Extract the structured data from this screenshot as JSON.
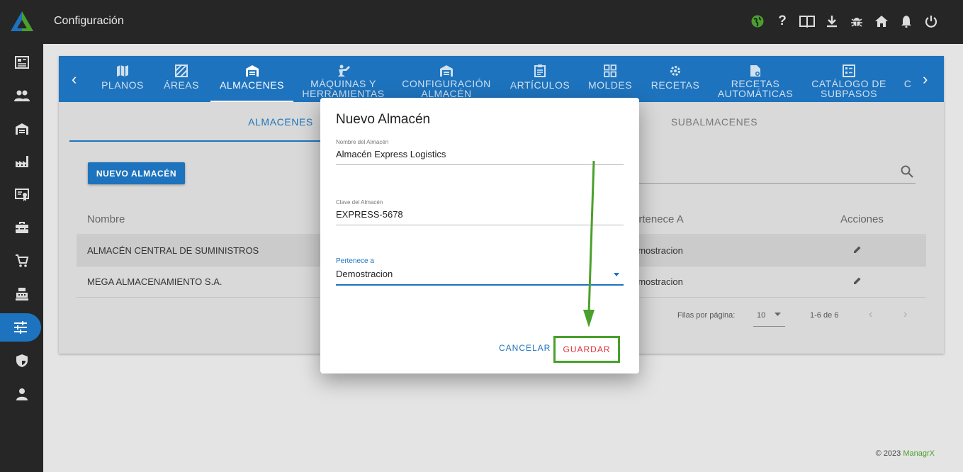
{
  "header": {
    "title": "Configuración",
    "icons": [
      "globe-icon",
      "help-icon",
      "manual-book-icon",
      "download-icon",
      "bug-icon",
      "home-icon",
      "notifications-bell-icon",
      "power-icon"
    ]
  },
  "sidebar": {
    "items": [
      {
        "icon": "dashboard-icon"
      },
      {
        "icon": "users-icon"
      },
      {
        "icon": "warehouse-icon"
      },
      {
        "icon": "factory-icon"
      },
      {
        "icon": "certificate-icon"
      },
      {
        "icon": "toolbox-icon"
      },
      {
        "icon": "cart-icon"
      },
      {
        "icon": "cash-register-icon"
      },
      {
        "icon": "settings-sliders-icon",
        "active": true
      },
      {
        "icon": "shield-icon"
      },
      {
        "icon": "user-icon"
      }
    ]
  },
  "tabs": [
    {
      "label": "PLANOS",
      "icon": "map-icon"
    },
    {
      "label": "ÁREAS",
      "icon": "area-icon"
    },
    {
      "label": "ALMACENES",
      "icon": "warehouse-icon",
      "active": true
    },
    {
      "label": "MÁQUINAS Y HERRAMIENTAS",
      "icon": "machine-icon"
    },
    {
      "label": "CONFIGURACIÓN ALMACÉN",
      "icon": "warehouse-config-icon"
    },
    {
      "label": "ARTÍCULOS",
      "icon": "clipboard-icon"
    },
    {
      "label": "MOLDES",
      "icon": "grid-icon"
    },
    {
      "label": "RECETAS",
      "icon": "recipe-gear-icon"
    },
    {
      "label": "RECETAS AUTOMÁTICAS",
      "icon": "auto-recipe-icon"
    },
    {
      "label": "CATÁLOGO DE SUBPASOS",
      "icon": "catalog-icon"
    },
    {
      "label": "C",
      "icon": ""
    }
  ],
  "subtabs": {
    "almacenes": "ALMACENES",
    "subalmacenes": "SUBALMACENES"
  },
  "main": {
    "new_button": "NUEVO ALMACÉN",
    "columns": {
      "nombre": "Nombre",
      "pertenece": "ertenece A",
      "acciones": "Acciones"
    },
    "rows": [
      {
        "nombre": "ALMACÉN CENTRAL DE SUMINISTROS",
        "pertenece": "emostracion"
      },
      {
        "nombre": "MEGA ALMACENAMIENTO S.A.",
        "pertenece": "emostracion"
      }
    ],
    "pager": {
      "rows_label": "Filas por página:",
      "rows_value": "10",
      "range": "1-6 de 6"
    }
  },
  "footer": {
    "copyright": "© 2023",
    "brand": "ManagrX"
  },
  "modal": {
    "title": "Nuevo Almacén",
    "nombre_label": "Nombre del Almacén",
    "nombre_value": "Almacén Express Logistics",
    "clave_label": "Clave del Almacén",
    "clave_value": "EXPRESS-5678",
    "pertenece_label": "Pertenece a",
    "pertenece_value": "Demostracion",
    "cancel": "CANCELAR",
    "save": "GUARDAR"
  },
  "colors": {
    "primary": "#1e73be",
    "annotation": "#4aa02c",
    "danger": "#e0303a",
    "dark": "#262626"
  }
}
